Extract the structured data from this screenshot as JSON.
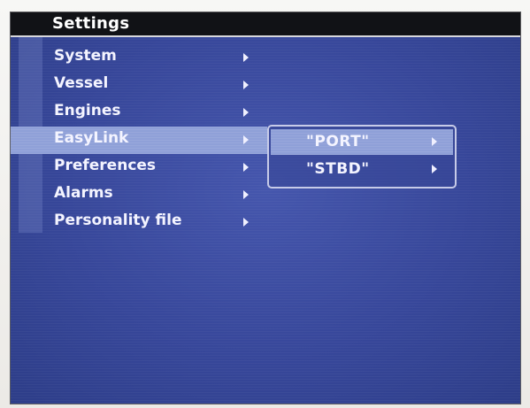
{
  "title": "Settings",
  "menu": {
    "items": [
      {
        "label": "System",
        "selected": false,
        "has_submenu": true
      },
      {
        "label": "Vessel",
        "selected": false,
        "has_submenu": true
      },
      {
        "label": "Engines",
        "selected": false,
        "has_submenu": true
      },
      {
        "label": "EasyLink",
        "selected": true,
        "has_submenu": true
      },
      {
        "label": "Preferences",
        "selected": false,
        "has_submenu": true
      },
      {
        "label": "Alarms",
        "selected": false,
        "has_submenu": true
      },
      {
        "label": "Personality file",
        "selected": false,
        "has_submenu": true
      }
    ]
  },
  "submenu": {
    "items": [
      {
        "label": "\"PORT\"",
        "selected": true,
        "has_submenu": true
      },
      {
        "label": "\"STBD\"",
        "selected": false,
        "has_submenu": true
      }
    ]
  },
  "colors": {
    "screen_background": "#3a4a98",
    "selected_highlight": "#8fa0d8",
    "title_bar": "#111216",
    "text": "#f4f4ff"
  },
  "icons": {
    "submenu_arrow": "chevron-right-icon"
  }
}
